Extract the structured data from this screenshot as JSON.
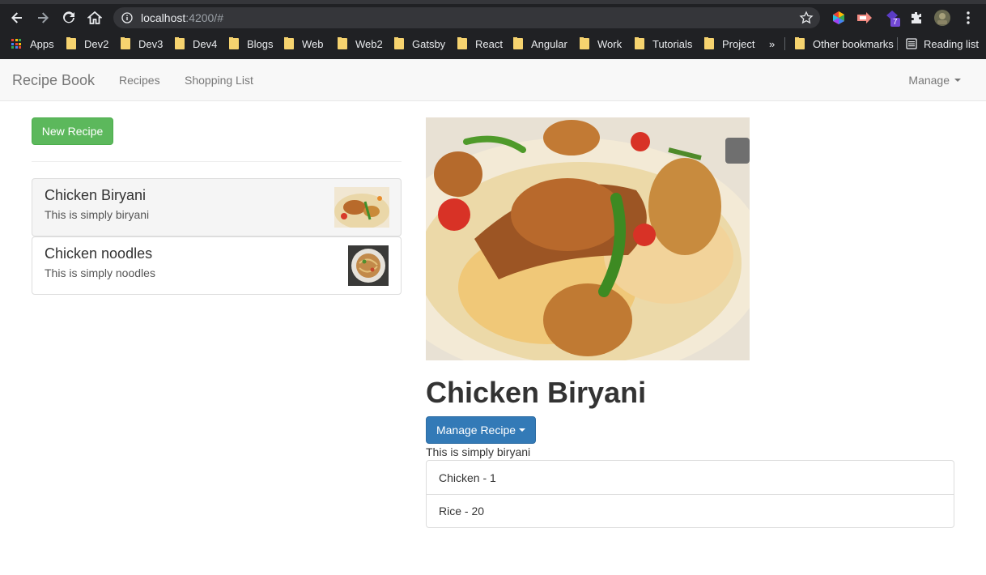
{
  "browser": {
    "url_host": "localhost",
    "url_rest": ":4200/#",
    "bookmarks": [
      "Apps",
      "Dev2",
      "Dev3",
      "Dev4",
      "Blogs",
      "Web",
      "Web2",
      "Gatsby",
      "React",
      "Angular",
      "Work",
      "Tutorials",
      "Project"
    ],
    "overflow_label": "»",
    "other_bookmarks": "Other bookmarks",
    "reading_list": "Reading list",
    "extension_badge": "7"
  },
  "navbar": {
    "brand": "Recipe Book",
    "links": [
      "Recipes",
      "Shopping List"
    ],
    "manage": "Manage"
  },
  "sidebar": {
    "new_button": "New Recipe",
    "recipes": [
      {
        "name": "Chicken Biryani",
        "description": "This is simply biryani"
      },
      {
        "name": "Chicken noodles",
        "description": "This is simply noodles"
      }
    ]
  },
  "detail": {
    "title": "Chicken Biryani",
    "manage_button": "Manage Recipe",
    "description": "This is simply biryani",
    "ingredients": [
      "Chicken - 1",
      "Rice - 20"
    ]
  }
}
